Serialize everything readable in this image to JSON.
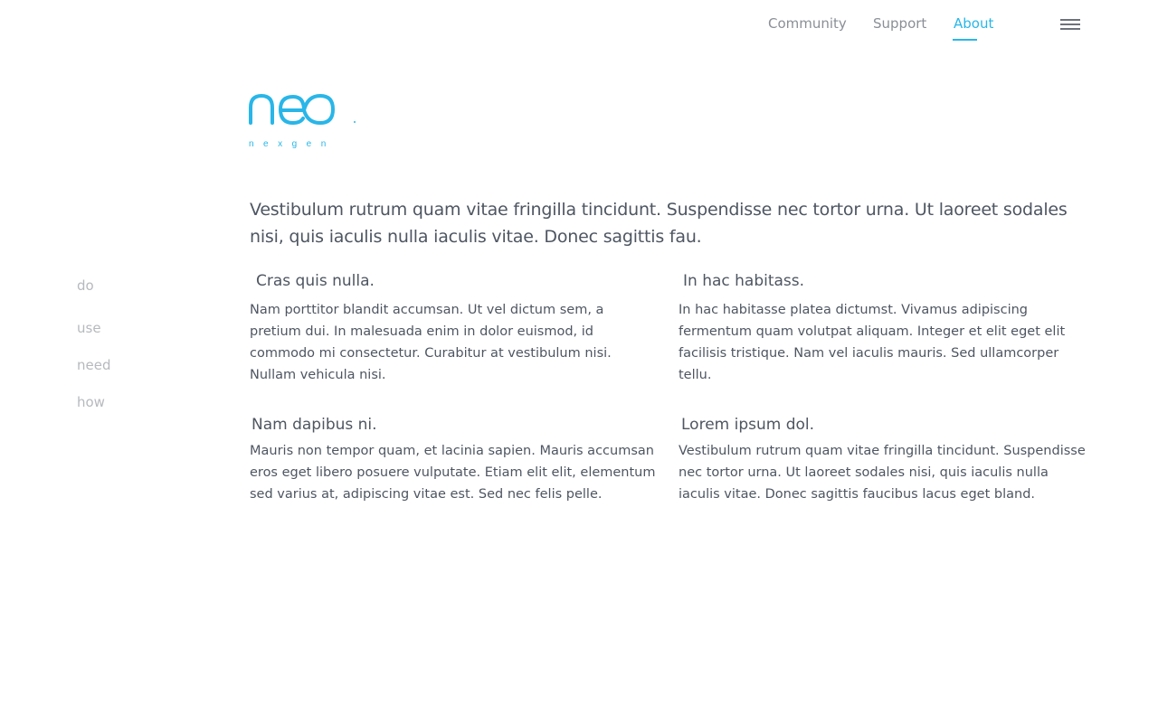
{
  "nav": {
    "links": [
      {
        "label": "Community"
      },
      {
        "label": "Support"
      },
      {
        "label": "About"
      }
    ],
    "active_color": "#29b6e8"
  },
  "logo": {
    "wordmark": "neo",
    "tagline": "n e x g e n",
    "color": "#29b6e8"
  },
  "side_nav": {
    "items": [
      {
        "label": "do"
      },
      {
        "label": "use"
      },
      {
        "label": "need"
      },
      {
        "label": "how"
      }
    ]
  },
  "intro": {
    "text": "Vestibulum rutrum quam vitae fringilla tincidunt. Suspendisse nec tortor urna. Ut laoreet sodales nisi, quis iaculis nulla iaculis vitae. Donec sagittis fau."
  },
  "features": [
    {
      "title": "Cras quis nulla.",
      "text": "Nam porttitor blandit accumsan. Ut vel dictum sem, a pretium dui. In malesuada enim in dolor euismod, id commodo mi consectetur. Curabitur at vestibulum nisi. Nullam vehicula nisi."
    },
    {
      "title": "In hac habitass.",
      "text": "In hac habitasse platea dictumst. Vivamus adipiscing fermentum quam volutpat aliquam. Integer et elit eget elit facilisis tristique. Nam vel iaculis mauris. Sed ullamcorper tellu."
    },
    {
      "title": "Nam dapibus ni.",
      "text": "Mauris non tempor quam, et lacinia sapien. Mauris accumsan eros eget libero posuere vulputate. Etiam elit elit, elementum sed varius at, adipiscing vitae est. Sed nec felis pelle."
    },
    {
      "title": "Lorem ipsum dol.",
      "text": "Vestibulum rutrum quam vitae fringilla tincidunt. Suspendisse nec tortor urna. Ut laoreet sodales nisi, quis iaculis nulla iaculis vitae. Donec sagittis faucibus lacus eget bland."
    }
  ]
}
